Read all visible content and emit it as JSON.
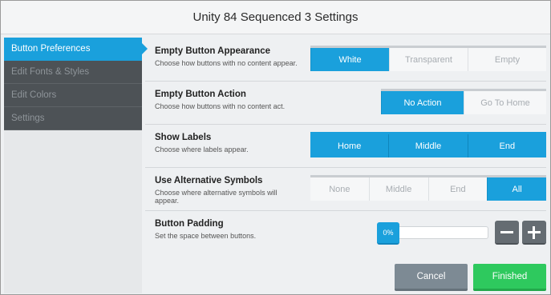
{
  "window": {
    "title": "Unity 84 Sequenced 3 Settings"
  },
  "sidebar": {
    "items": [
      {
        "label": "Button Preferences",
        "active": true
      },
      {
        "label": "Edit Fonts & Styles",
        "active": false
      },
      {
        "label": "Edit Colors",
        "active": false
      },
      {
        "label": "Settings",
        "active": false
      }
    ]
  },
  "settings": {
    "empty_appearance": {
      "title": "Empty Button Appearance",
      "desc": "Choose how buttons with no content appear.",
      "options": [
        "White",
        "Transparent",
        "Empty"
      ],
      "selected": "White"
    },
    "empty_action": {
      "title": "Empty Button Action",
      "desc": "Choose how buttons with no content act.",
      "options": [
        "No Action",
        "Go To Home"
      ],
      "selected": "No Action"
    },
    "show_labels": {
      "title": "Show Labels",
      "desc": "Choose where labels appear.",
      "options": [
        "Home",
        "Middle",
        "End"
      ],
      "selected": [
        "Home",
        "Middle",
        "End"
      ]
    },
    "alt_symbols": {
      "title": "Use Alternative Symbols",
      "desc_line1": "Choose where alternative symbols will",
      "desc_line2": "appear.",
      "options": [
        "None",
        "Middle",
        "End",
        "All"
      ],
      "selected": "All"
    },
    "padding": {
      "title": "Button Padding",
      "desc": "Set the space between buttons.",
      "value_label": "0%",
      "value": 0
    }
  },
  "footer": {
    "cancel_label": "Cancel",
    "finish_label": "Finished"
  },
  "colors": {
    "accent": "#1aa0dc",
    "sidebar_bg": "#4d5256",
    "finish": "#2ec95e",
    "cancel": "#7d8a94"
  },
  "icons": [
    "minus-icon",
    "plus-icon"
  ]
}
